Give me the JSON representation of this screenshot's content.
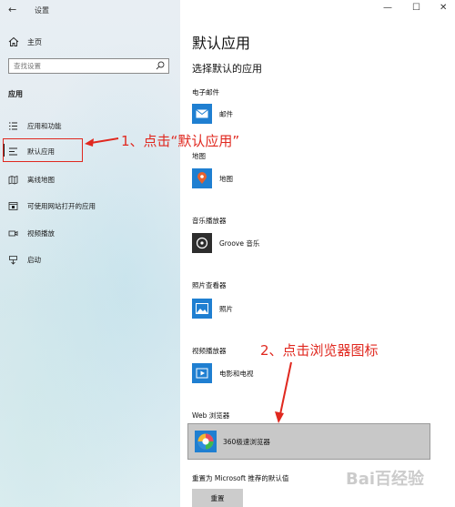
{
  "window": {
    "title": "设置",
    "back": "←",
    "minimize": "—",
    "maximize": "☐",
    "close": "✕"
  },
  "sidebar": {
    "home_label": "主页",
    "search_placeholder": "查找设置",
    "section": "应用",
    "items": [
      {
        "label": "应用和功能"
      },
      {
        "label": "默认应用"
      },
      {
        "label": "离线地图"
      },
      {
        "label": "可使用网站打开的应用"
      },
      {
        "label": "视频播放"
      },
      {
        "label": "启动"
      }
    ]
  },
  "main": {
    "title": "默认应用",
    "subtitle": "选择默认的应用",
    "categories": [
      {
        "heading": "电子邮件",
        "app": "邮件"
      },
      {
        "heading": "地图",
        "app": "地图"
      },
      {
        "heading": "音乐播放器",
        "app": "Groove 音乐"
      },
      {
        "heading": "照片查看器",
        "app": "照片"
      },
      {
        "heading": "视频播放器",
        "app": "电影和电视"
      },
      {
        "heading": "Web 浏览器",
        "app": "360极速浏览器"
      }
    ],
    "reset_label": "重置为 Microsoft 推荐的默认值",
    "reset_button": "重置"
  },
  "annotations": {
    "step1": "1、点击“默认应用”",
    "step2": "2、点击浏览器图标"
  },
  "watermark": "Bai百经验",
  "colors": {
    "accent": "#1f7fd1",
    "annotation": "#e0281f",
    "highlight_row": "#c8c8c8"
  }
}
